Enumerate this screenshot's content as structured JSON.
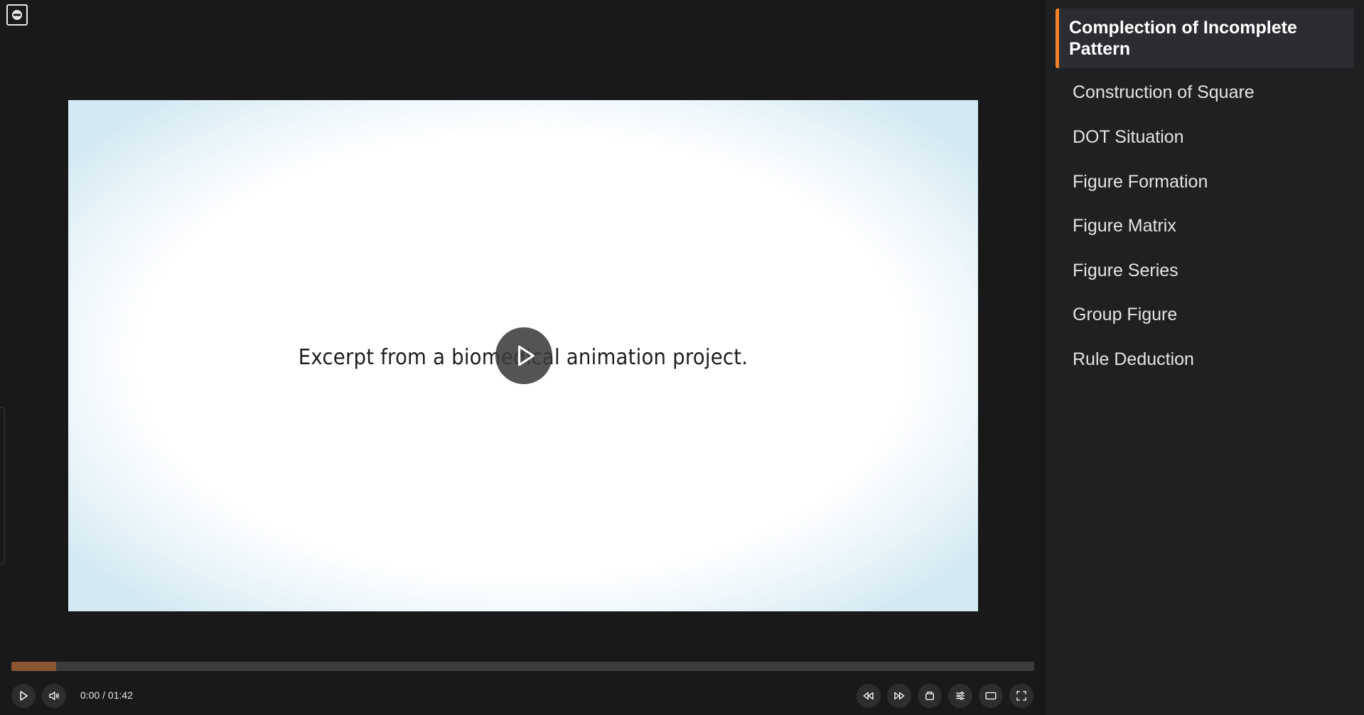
{
  "video": {
    "caption": "Excerpt from a biomedical animation project.",
    "progress_fraction": 0.044,
    "time_display": "0:00 / 01:42"
  },
  "sidebar": {
    "items": [
      {
        "label": "Complection of Incomplete Pattern",
        "active": true
      },
      {
        "label": "Construction of Square",
        "active": false
      },
      {
        "label": "DOT Situation",
        "active": false
      },
      {
        "label": "Figure Formation",
        "active": false
      },
      {
        "label": "Figure Matrix",
        "active": false
      },
      {
        "label": "Figure Series",
        "active": false
      },
      {
        "label": "Group Figure",
        "active": false
      },
      {
        "label": "Rule Deduction",
        "active": false
      }
    ]
  },
  "colors": {
    "accent": "#f0822e",
    "progress": "#8a5530",
    "background": "#191919",
    "sidebar_bg": "#1f2022"
  },
  "icons": {
    "logo": "circle-logo-icon",
    "big_play": "play-icon",
    "controls": [
      "play-icon",
      "volume-icon",
      "rewind-icon",
      "fast-forward-icon",
      "cast-icon",
      "settings-sliders-icon",
      "theater-mode-icon",
      "fullscreen-icon"
    ]
  }
}
